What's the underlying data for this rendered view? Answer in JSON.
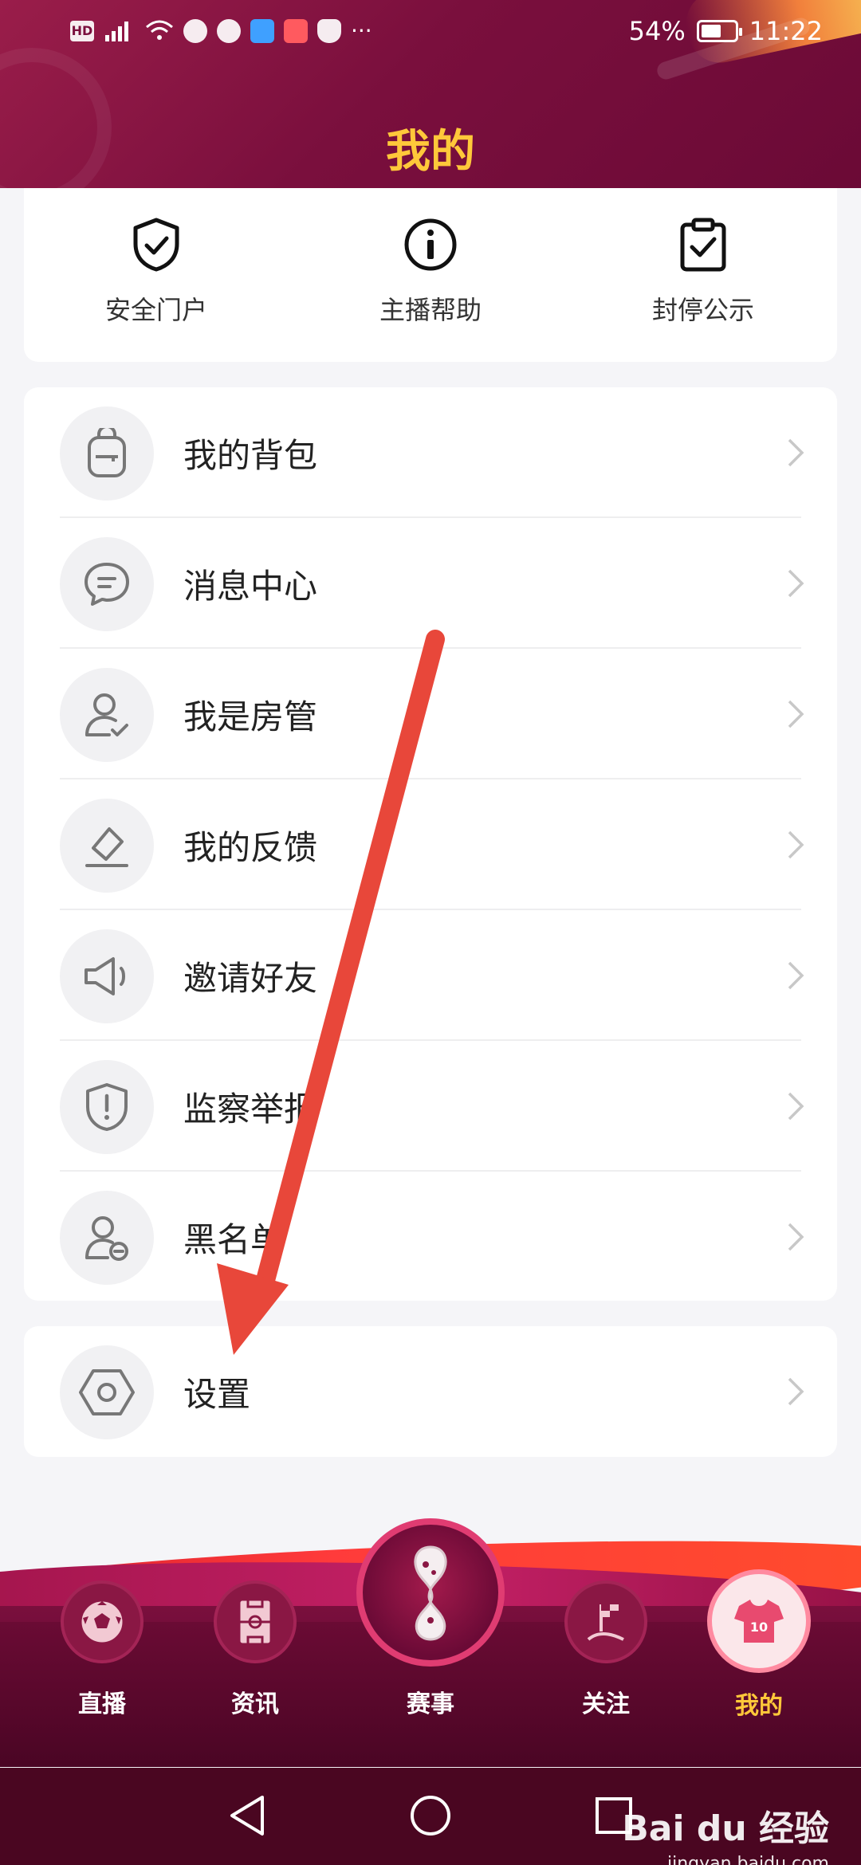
{
  "status_bar": {
    "battery": "54%",
    "time": "11:22",
    "left_icons": [
      "hd-icon",
      "4g-signal-icon",
      "wifi-icon",
      "chat-icon",
      "hand-icon",
      "cloud-icon",
      "huawei-icon",
      "shield-icon",
      "more-dots-icon"
    ],
    "hd_label": "HD",
    "more": "···"
  },
  "header": {
    "title": "我的"
  },
  "quick_links": [
    {
      "label": "安全门户",
      "icon": "shield-check-icon"
    },
    {
      "label": "主播帮助",
      "icon": "info-circle-icon"
    },
    {
      "label": "封停公示",
      "icon": "clipboard-check-icon"
    }
  ],
  "menu": [
    {
      "label": "我的背包",
      "icon": "backpack-icon"
    },
    {
      "label": "消息中心",
      "icon": "message-icon"
    },
    {
      "label": "我是房管",
      "icon": "user-check-icon"
    },
    {
      "label": "我的反馈",
      "icon": "feedback-icon"
    },
    {
      "label": "邀请好友",
      "icon": "megaphone-icon"
    },
    {
      "label": "监察举报",
      "icon": "report-shield-icon"
    },
    {
      "label": "黑名单",
      "icon": "user-block-icon"
    }
  ],
  "settings": {
    "label": "设置",
    "icon": "hexagon-gear-icon"
  },
  "bottom_nav": [
    {
      "label": "直播",
      "icon": "soccer-ball-icon",
      "active": false
    },
    {
      "label": "资讯",
      "icon": "pitch-icon",
      "active": false
    },
    {
      "label": "赛事",
      "icon": "trophy-emblem-icon",
      "active": false
    },
    {
      "label": "关注",
      "icon": "corner-flag-icon",
      "active": false
    },
    {
      "label": "我的",
      "icon": "jersey-icon",
      "active": true
    }
  ],
  "watermark": {
    "brand": "Bai du 经验",
    "url": "jingyan.baidu.com"
  },
  "colors": {
    "header": "#7a0f3d",
    "title": "#ffc83a",
    "active_tab": "#ffc83a",
    "annotation_arrow": "#e8473a"
  }
}
